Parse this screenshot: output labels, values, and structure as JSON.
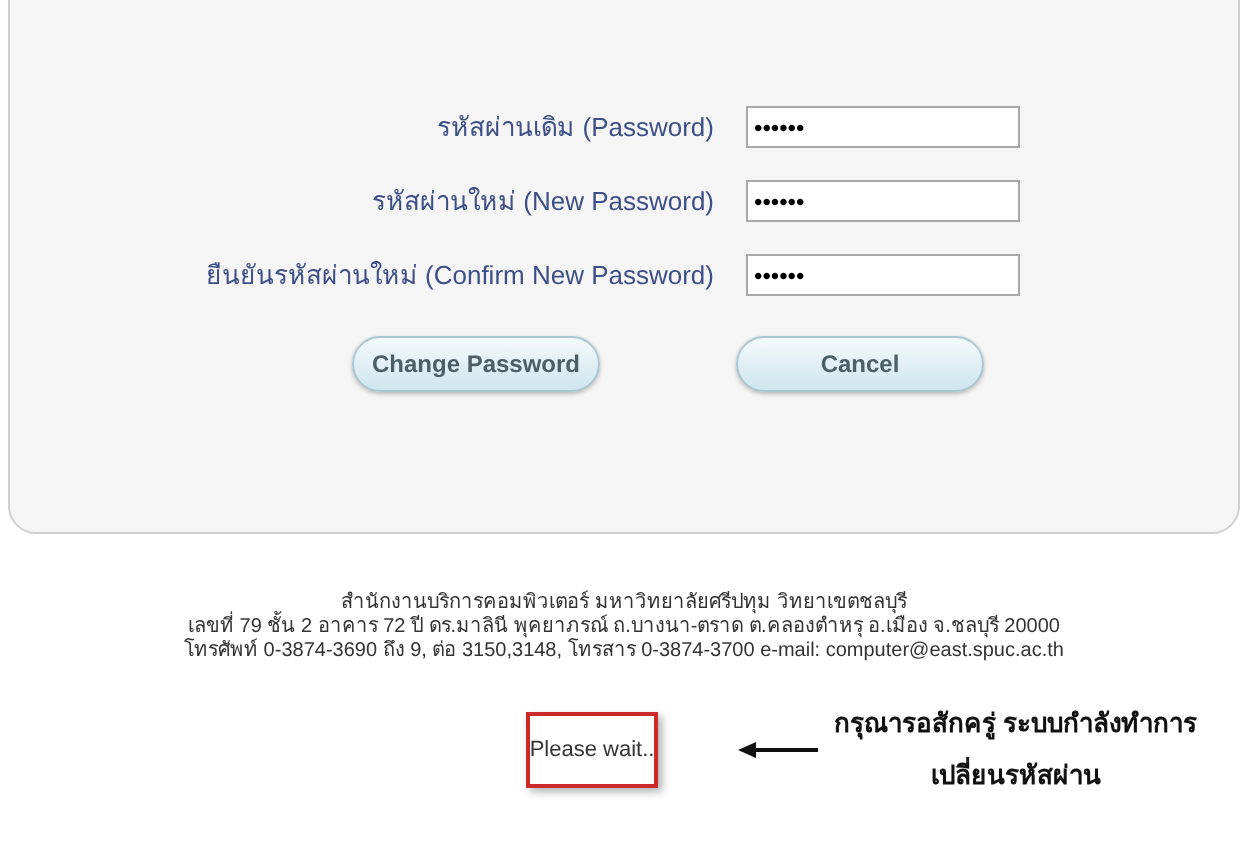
{
  "form": {
    "fields": [
      {
        "label": "รหัสผ่านเดิม (Password)",
        "value": "••••••"
      },
      {
        "label": "รหัสผ่านใหม่ (New Password)",
        "value": "••••••"
      },
      {
        "label": "ยืนยันรหัสผ่านใหม่ (Confirm New Password)",
        "value": "••••••"
      }
    ],
    "buttons": [
      "Change Password",
      "Cancel"
    ]
  },
  "footer": [
    "สำนักงานบริการคอมพิวเตอร์ มหาวิทยาลัยศรีปทุม วิทยาเขตชลบุรี",
    "เลขที่ 79 ชั้น 2 อาคาร 72 ปี ดร.มาลินี พุคยาภรณ์ ถ.บางนา-ตราด ต.คลองตำหรุ อ.เมือง จ.ชลบุรี 20000",
    "โทรศัพท์ 0-3874-3690 ถึง 9, ต่อ 3150,3148, โทรสาร 0-3874-3700 e-mail: computer@east.spuc.ac.th"
  ],
  "status": {
    "message": "Please wait..",
    "note": [
      "กรุณารอสักครู่ ระบบกำลังทำการ",
      "เปลี่ยนรหัสผ่าน"
    ]
  }
}
